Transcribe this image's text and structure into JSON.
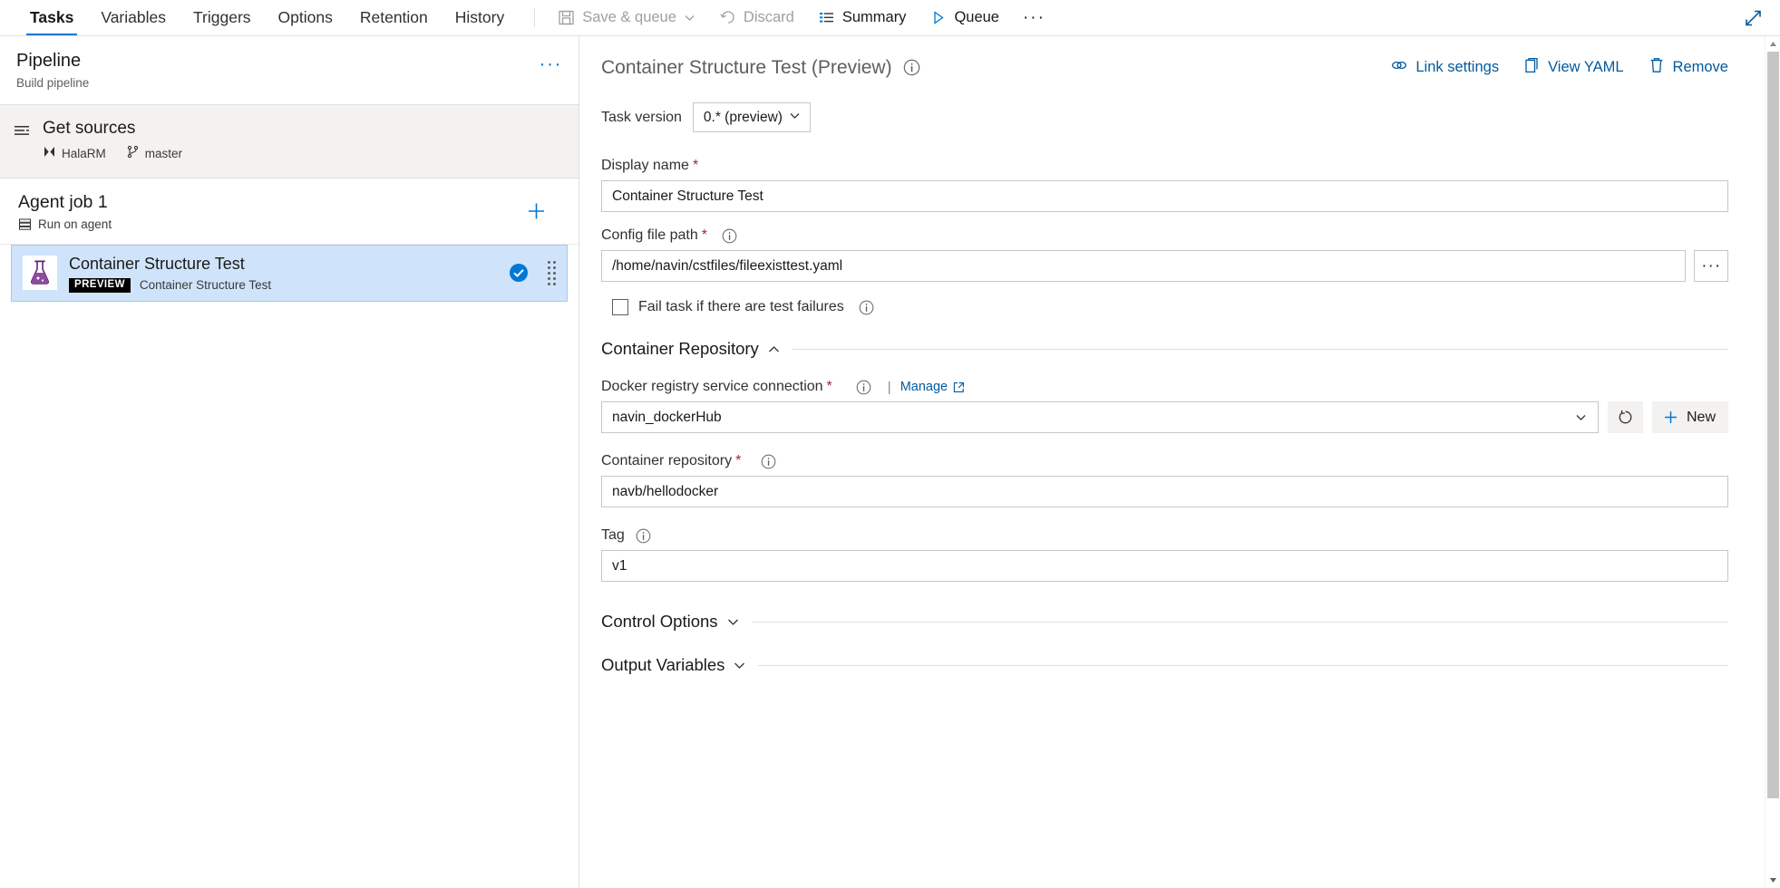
{
  "topbar": {
    "tabs": [
      {
        "label": "Tasks",
        "active": true
      },
      {
        "label": "Variables",
        "active": false
      },
      {
        "label": "Triggers",
        "active": false
      },
      {
        "label": "Options",
        "active": false
      },
      {
        "label": "Retention",
        "active": false
      },
      {
        "label": "History",
        "active": false
      }
    ],
    "toolbar": {
      "save_queue": "Save & queue",
      "discard": "Discard",
      "summary": "Summary",
      "queue": "Queue",
      "overflow": "···"
    },
    "expand_title": "Expand"
  },
  "sidebar": {
    "pipeline": {
      "title": "Pipeline",
      "subtitle": "Build pipeline",
      "menu": "···"
    },
    "get_sources": {
      "title": "Get sources",
      "repo": "HalaRM",
      "branch": "master"
    },
    "job": {
      "title": "Agent job 1",
      "subtitle": "Run on agent"
    },
    "task": {
      "name": "Container Structure Test",
      "badge": "PREVIEW",
      "description": "Container Structure Test"
    }
  },
  "panel": {
    "title": "Container Structure Test (Preview)",
    "actions": {
      "link_settings": "Link settings",
      "view_yaml": "View YAML",
      "remove": "Remove"
    },
    "task_version": {
      "label": "Task version",
      "value": "0.* (preview)"
    },
    "display_name": {
      "label": "Display name",
      "required": "*",
      "value": "Container Structure Test"
    },
    "config_file_path": {
      "label": "Config file path",
      "required": "*",
      "value": "/home/navin/cstfiles/fileexisttest.yaml",
      "browse": "···"
    },
    "fail_task": {
      "label": "Fail task if there are test failures",
      "checked": false
    },
    "container_repository_section": {
      "title": "Container Repository",
      "docker_connection": {
        "label": "Docker registry service connection",
        "required": "*",
        "separator": "|",
        "manage": "Manage",
        "value": "navin_dockerHub",
        "new_button": "New"
      },
      "container_repository": {
        "label": "Container repository",
        "required": "*",
        "value": "navb/hellodocker"
      },
      "tag": {
        "label": "Tag",
        "value": "v1"
      }
    },
    "control_options": {
      "title": "Control Options"
    },
    "output_variables": {
      "title": "Output Variables"
    }
  },
  "colors": {
    "accent": "#0078d4",
    "link": "#005a9e",
    "selection": "#cfe4fa",
    "required": "#a4262c"
  }
}
